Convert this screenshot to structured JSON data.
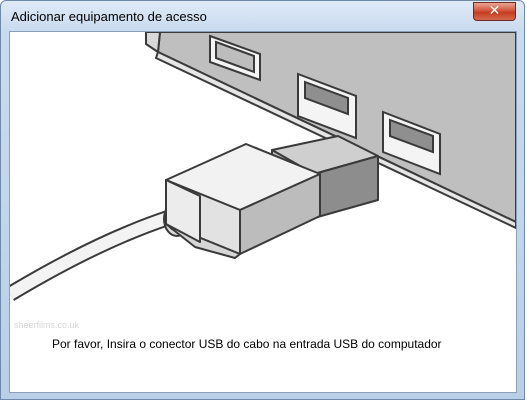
{
  "window": {
    "title": "Adicionar equipamento de acesso",
    "close_glyph": "✕"
  },
  "content": {
    "watermark": "sheerfilms.co.uk",
    "instruction": "Por favor, Insira o conector USB do cabo na entrada USB do computador"
  },
  "icons": {
    "close": "close-icon",
    "illustration": "usb-plug-into-laptop-illustration"
  }
}
